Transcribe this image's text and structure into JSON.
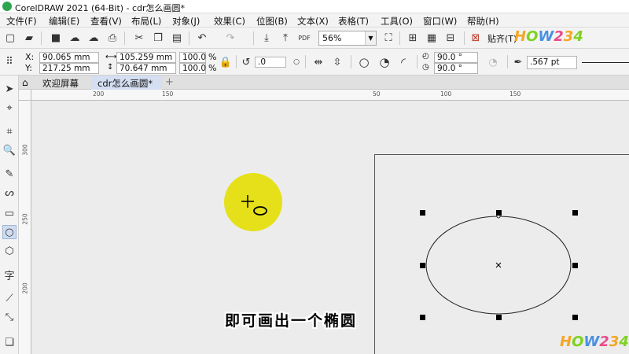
{
  "window": {
    "title": "CorelDRAW 2021 (64-Bit) - cdr怎么画圆*"
  },
  "menu": [
    "文件(F)",
    "编辑(E)",
    "查看(V)",
    "布局(L)",
    "对象(J)",
    "效果(C)",
    "位图(B)",
    "文本(X)",
    "表格(T)",
    "工具(O)",
    "窗口(W)",
    "帮助(H)"
  ],
  "toolbar": {
    "zoom": "56%",
    "snap_label": "贴齐(T)"
  },
  "properties": {
    "x_label": "X:",
    "x": "90.065 mm",
    "y_label": "Y:",
    "y": "217.25 mm",
    "width": "105.259 mm",
    "height": "70.647 mm",
    "scale_w": "100.0",
    "scale_h": "100.0",
    "pct": "%",
    "rotation": ".0",
    "start_angle": "90.0 °",
    "end_angle": "90.0 °",
    "outline": ".567 pt"
  },
  "tabs": {
    "welcome": "欢迎屏幕",
    "document": "cdr怎么画圆*"
  },
  "ruler": {
    "top": [
      "200",
      "150",
      "50",
      "100",
      "150"
    ],
    "left": [
      "300",
      "250",
      "200"
    ]
  },
  "subtitle": "即可画出一个椭圆",
  "watermark": "HOW234",
  "colors": {
    "halo": "#e6e01a",
    "active_tab": "#d4dff2"
  }
}
